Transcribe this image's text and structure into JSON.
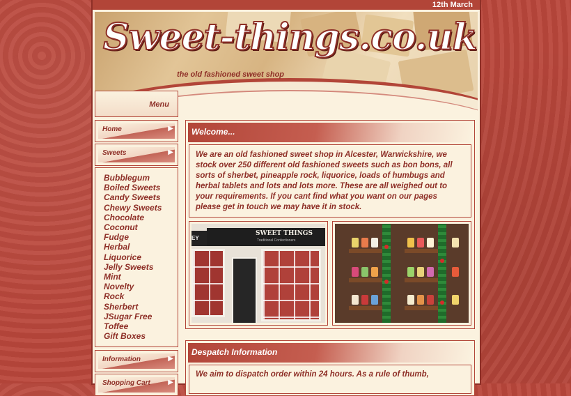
{
  "topbar": {
    "date": "12th March"
  },
  "header": {
    "logo_text": "Sweet-things.co.uk",
    "tagline": "the old fashioned sweet shop"
  },
  "sidebar": {
    "menu_label": "Menu",
    "buttons": [
      {
        "label": "Home"
      },
      {
        "label": "Sweets"
      },
      {
        "label": "Information"
      },
      {
        "label": "Shopping Cart"
      }
    ],
    "sweets": [
      "Bubblegum",
      "Boiled Sweets",
      "Candy Sweets",
      "Chewy Sweets",
      "Chocolate",
      "Coconut",
      "Fudge",
      "Herbal",
      "Liquorice",
      "Jelly Sweets",
      "Mint",
      "Novelty",
      "Rock",
      "Sherbert",
      "JSugar Free",
      "Toffee",
      "Gift Boxes"
    ]
  },
  "welcome": {
    "title": "Welcome...",
    "text": "We are an old fashioned sweet shop in Alcester, Warwickshire, we stock over 250 different old fashioned sweets such as bon bons, all sorts of sherbet, pineapple rock, liquorice, loads of humbugs and herbal tablets and lots and lots   more. These are all weighed out to your requirements. If you cant find what you want on our pages please get in touch we may have it in stock.",
    "photo1": {
      "sign": "SWEET THINGS",
      "sign_sub": "Traditional Confectioners",
      "left_sign": "EY FRIDAY"
    }
  },
  "despatch": {
    "title": "Despatch Information",
    "text": "We aim to dispatch order within 24 hours. As a rule of thumb,"
  },
  "colors": {
    "brand": "#b24538",
    "brand_dark": "#8e2f27",
    "cream": "#fbf2df"
  }
}
